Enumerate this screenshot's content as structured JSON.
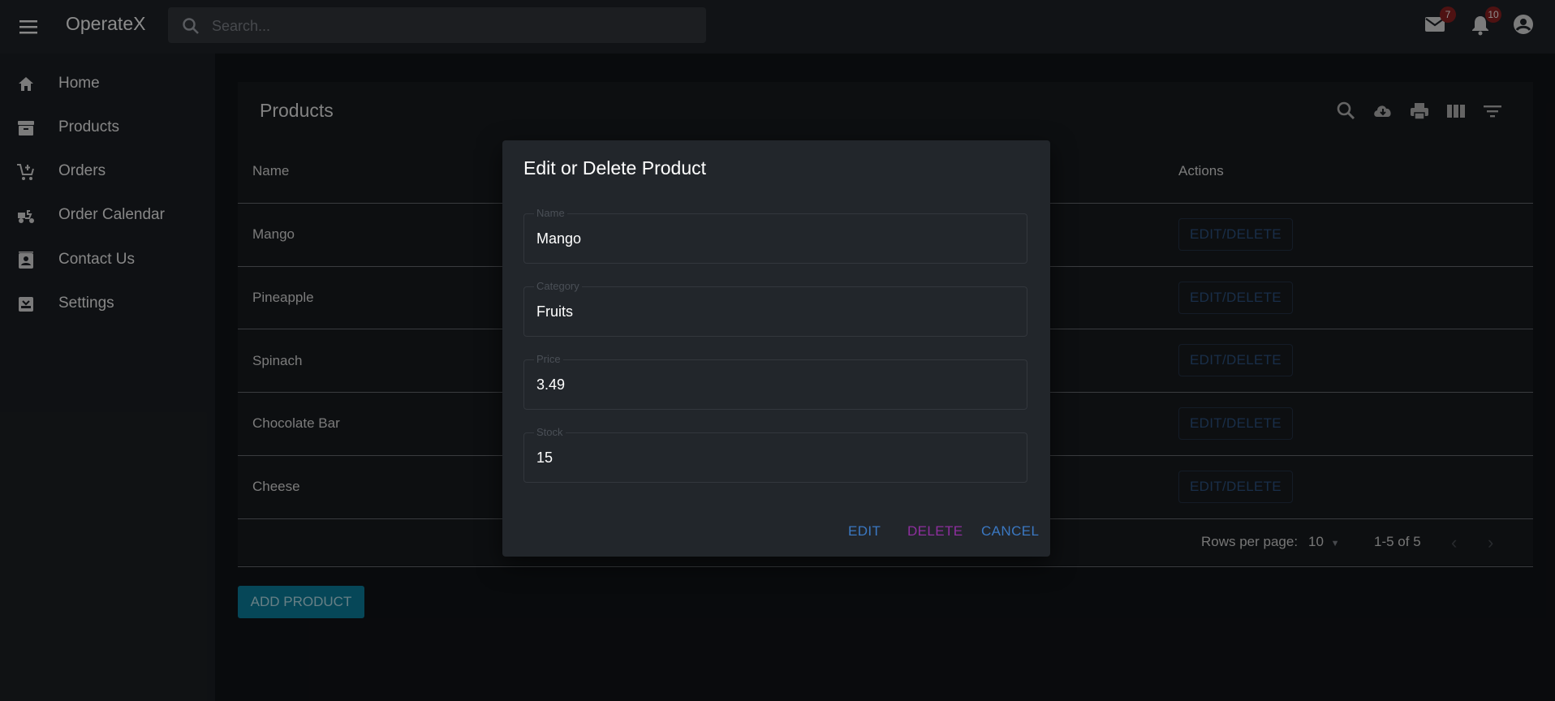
{
  "app": {
    "title": "OperateX"
  },
  "search": {
    "placeholder": "Search..."
  },
  "badges": {
    "mail": "7",
    "notifications": "10"
  },
  "sidebar": {
    "items": [
      {
        "label": "Home",
        "icon": "home-icon"
      },
      {
        "label": "Products",
        "icon": "archive-icon"
      },
      {
        "label": "Orders",
        "icon": "cart-icon"
      },
      {
        "label": "Order Calendar",
        "icon": "delivery-icon"
      },
      {
        "label": "Contact Us",
        "icon": "contact-icon"
      },
      {
        "label": "Settings",
        "icon": "settings-icon"
      }
    ]
  },
  "products": {
    "title": "Products",
    "columns": {
      "name": "Name",
      "actions": "Actions"
    },
    "rows": [
      {
        "name": "Mango",
        "action": "EDIT/DELETE"
      },
      {
        "name": "Pineapple",
        "action": "EDIT/DELETE"
      },
      {
        "name": "Spinach",
        "action": "EDIT/DELETE"
      },
      {
        "name": "Chocolate Bar",
        "action": "EDIT/DELETE"
      },
      {
        "name": "Cheese",
        "action": "EDIT/DELETE"
      }
    ],
    "pagination": {
      "rows_per_page_label": "Rows per page:",
      "rows_per_page": "10",
      "range": "1-5 of 5"
    },
    "add_button": "ADD PRODUCT"
  },
  "dialog": {
    "title": "Edit or Delete Product",
    "fields": [
      {
        "label": "Name",
        "value": "Mango"
      },
      {
        "label": "Category",
        "value": "Fruits"
      },
      {
        "label": "Price",
        "value": "3.49"
      },
      {
        "label": "Stock",
        "value": "15"
      }
    ],
    "buttons": {
      "edit": "EDIT",
      "delete": "DELETE",
      "cancel": "CANCEL"
    },
    "colors": {
      "edit": "#3b78c2",
      "delete": "#8e2f9e",
      "cancel": "#3b78c2"
    }
  }
}
